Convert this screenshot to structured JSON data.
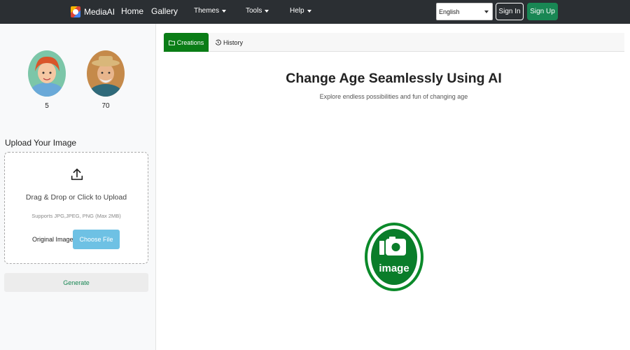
{
  "navbar": {
    "brand": "MediaAI",
    "links": [
      "Home",
      "Gallery"
    ],
    "dropdowns": [
      "Themes",
      "Tools",
      "Help"
    ],
    "language": "English",
    "sign_in": "Sign In",
    "sign_up": "Sign Up"
  },
  "sidebar": {
    "ages": [
      {
        "label": "5"
      },
      {
        "label": "70"
      }
    ],
    "upload_title": "Upload Your Image",
    "drop_text": "Drag & Drop or Click to Upload",
    "supports_text": "Supports JPG,JPEG, PNG (Max 2MB)",
    "original_label": "Original Image",
    "choose_file": "Choose File",
    "generate": "Generate"
  },
  "tabs": {
    "creations": "Creations",
    "history": "History"
  },
  "main": {
    "title": "Change Age Seamlessly Using AI",
    "subtitle": "Explore endless possibilities and fun of changing age",
    "placeholder_word": "image"
  },
  "colors": {
    "navbar": "#2b2f33",
    "brand_green": "#198754",
    "tab_green": "#0a7d16",
    "choose_blue": "#6ec1e4"
  },
  "icons": [
    "upload-icon",
    "folder-icon",
    "history-icon",
    "image-placeholder-icon",
    "caret-down-icon"
  ]
}
